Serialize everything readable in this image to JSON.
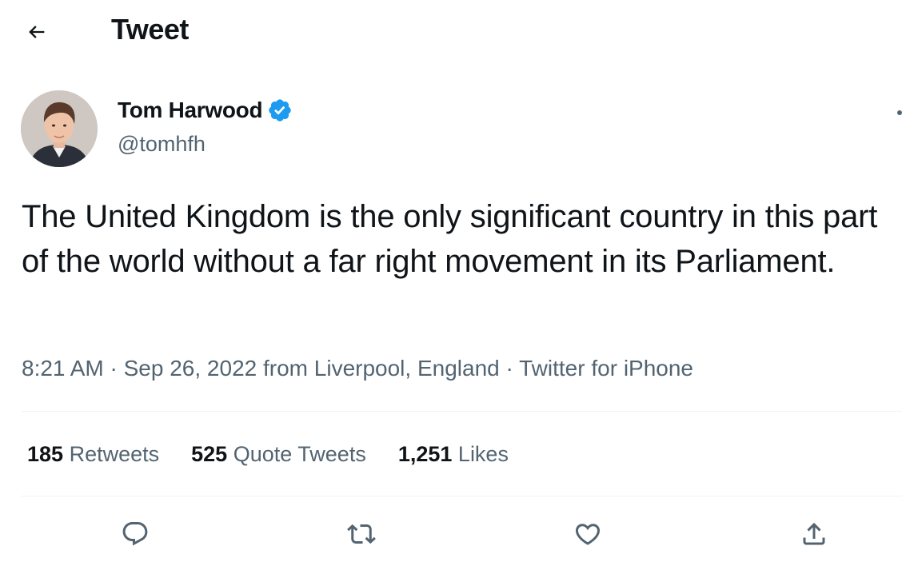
{
  "header": {
    "title": "Tweet",
    "back_icon": "arrow-left-icon"
  },
  "tweet": {
    "author": {
      "name": "Tom Harwood",
      "handle": "@tomhfh",
      "verified": true,
      "verified_color": "#1d9bf0"
    },
    "text": "The United Kingdom is the only significant country in this part of the world without a far right movement in its Parliament.",
    "time": "8:21 AM",
    "date": "Sep 26, 2022",
    "location": "from Liverpool, England",
    "source": "Twitter for iPhone",
    "separator": "·"
  },
  "stats": {
    "retweets": {
      "count": "185",
      "label": "Retweets"
    },
    "quotes": {
      "count": "525",
      "label": "Quote Tweets"
    },
    "likes": {
      "count": "1,251",
      "label": "Likes"
    }
  },
  "actions": [
    "reply-icon",
    "retweet-icon",
    "like-icon",
    "share-icon"
  ],
  "colors": {
    "text": "#0f1419",
    "secondary": "#536471",
    "divider": "#eff3f4"
  }
}
